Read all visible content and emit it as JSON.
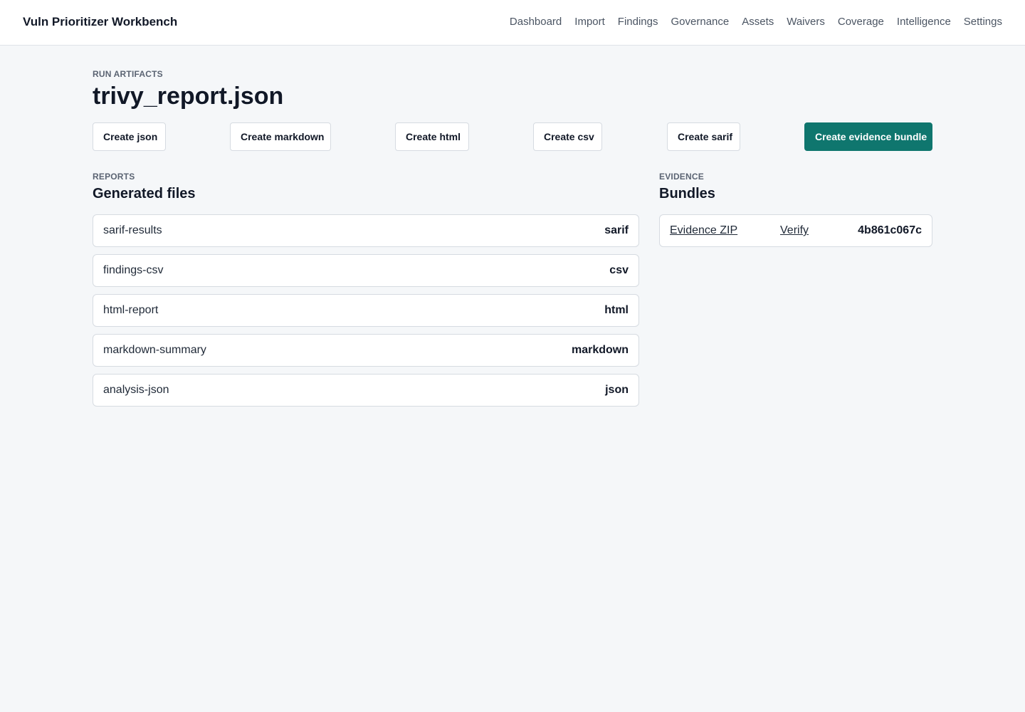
{
  "header": {
    "brand": "Vuln Prioritizer Workbench",
    "nav": [
      "Dashboard",
      "Import",
      "Findings",
      "Governance",
      "Assets",
      "Waivers",
      "Coverage",
      "Intelligence",
      "Settings"
    ]
  },
  "page": {
    "eyebrow": "RUN ARTIFACTS",
    "title": "trivy_report.json"
  },
  "actions": {
    "create_json": "Create json",
    "create_markdown": "Create markdown",
    "create_html": "Create html",
    "create_csv": "Create csv",
    "create_sarif": "Create sarif",
    "create_bundle": "Create evidence bundle"
  },
  "reports": {
    "eyebrow": "REPORTS",
    "title": "Generated files",
    "files": [
      {
        "name": "sarif-results",
        "type": "sarif"
      },
      {
        "name": "findings-csv",
        "type": "csv"
      },
      {
        "name": "html-report",
        "type": "html"
      },
      {
        "name": "markdown-summary",
        "type": "markdown"
      },
      {
        "name": "analysis-json",
        "type": "json"
      }
    ]
  },
  "evidence": {
    "eyebrow": "EVIDENCE",
    "title": "Bundles",
    "zip_label": "Evidence ZIP",
    "verify_label": "Verify",
    "hash": "4b861c067c"
  },
  "colors": {
    "accent": "#0f766e",
    "background": "#f5f7f9",
    "border": "#d6dbe1"
  }
}
